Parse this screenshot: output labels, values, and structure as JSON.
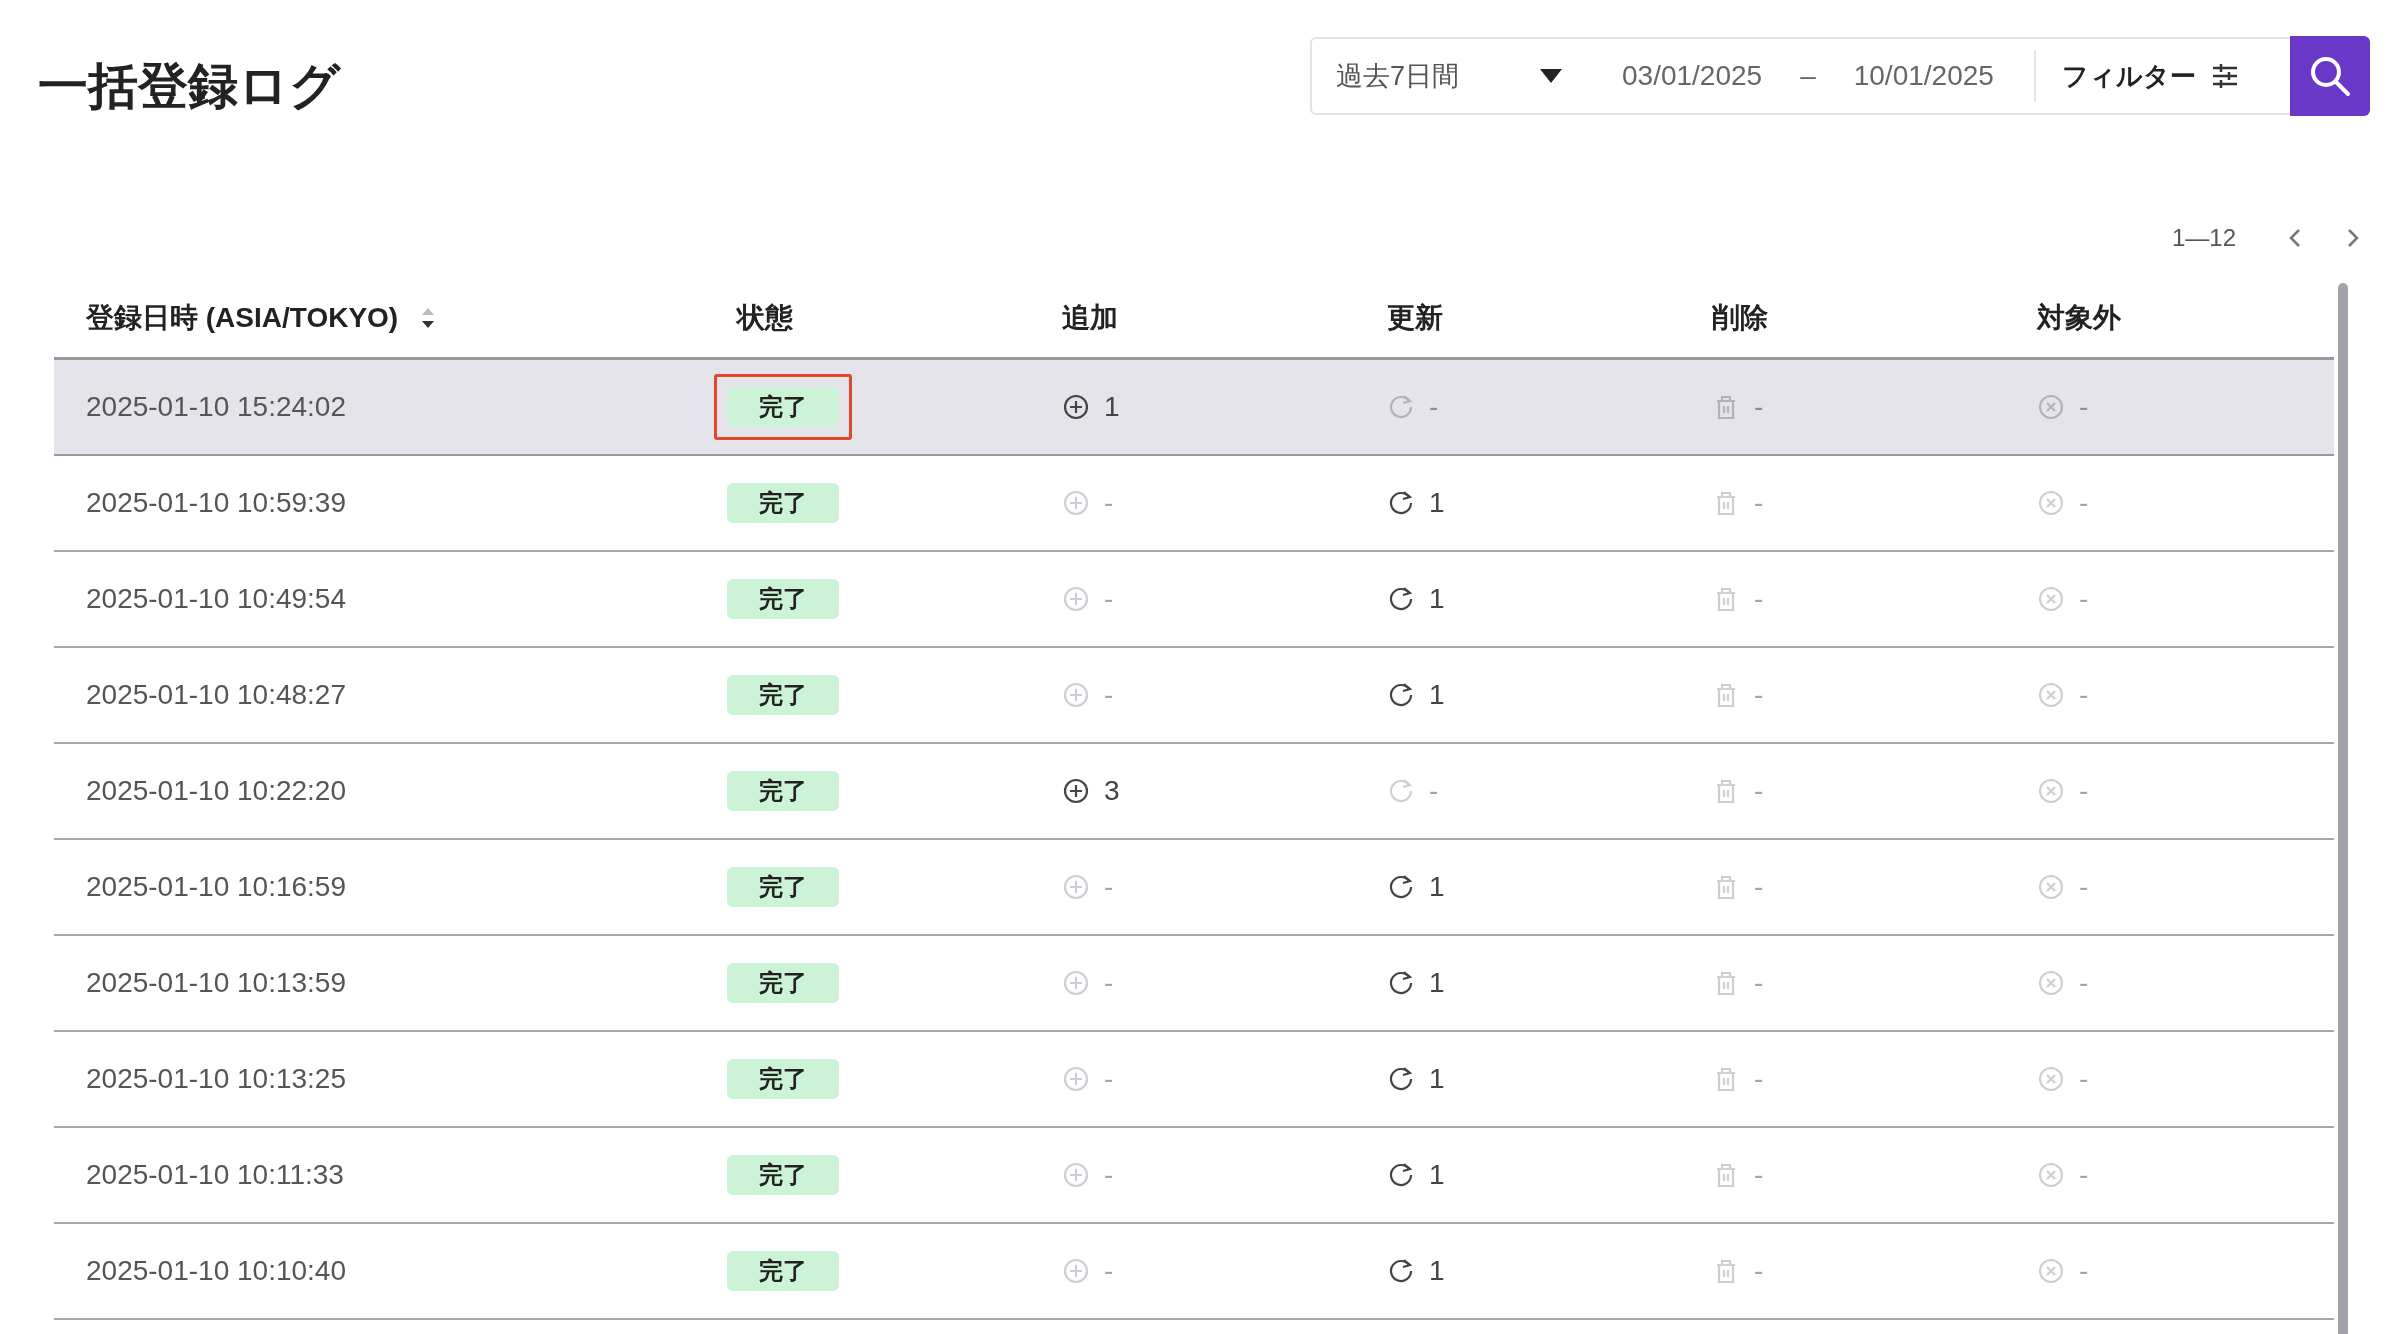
{
  "title": "一括登録ログ",
  "toolbar": {
    "period": "過去7日間",
    "date_from": "03/01/2025",
    "date_separator": "–",
    "date_to": "10/01/2025",
    "filter_label": "フィルター"
  },
  "pagination": {
    "range": "1—12"
  },
  "table": {
    "columns": [
      {
        "label": "登録日時 (ASIA/TOKYO)",
        "sortable": true
      },
      {
        "label": "状態",
        "sortable": false
      },
      {
        "label": "追加",
        "sortable": false
      },
      {
        "label": "更新",
        "sortable": false
      },
      {
        "label": "削除",
        "sortable": false
      },
      {
        "label": "対象外",
        "sortable": false
      }
    ],
    "rows": [
      {
        "datetime": "2025-01-10 15:24:02",
        "status": "完了",
        "selected": true,
        "status_outlined": true,
        "added": {
          "value": "1",
          "active": true
        },
        "updated": {
          "value": "-",
          "active": false
        },
        "deleted": {
          "value": "-",
          "active": false
        },
        "excluded": {
          "value": "-",
          "active": false
        }
      },
      {
        "datetime": "2025-01-10 10:59:39",
        "status": "完了",
        "selected": false,
        "status_outlined": false,
        "added": {
          "value": "-",
          "active": false
        },
        "updated": {
          "value": "1",
          "active": true
        },
        "deleted": {
          "value": "-",
          "active": false
        },
        "excluded": {
          "value": "-",
          "active": false
        }
      },
      {
        "datetime": "2025-01-10 10:49:54",
        "status": "完了",
        "selected": false,
        "status_outlined": false,
        "added": {
          "value": "-",
          "active": false
        },
        "updated": {
          "value": "1",
          "active": true
        },
        "deleted": {
          "value": "-",
          "active": false
        },
        "excluded": {
          "value": "-",
          "active": false
        }
      },
      {
        "datetime": "2025-01-10 10:48:27",
        "status": "完了",
        "selected": false,
        "status_outlined": false,
        "added": {
          "value": "-",
          "active": false
        },
        "updated": {
          "value": "1",
          "active": true
        },
        "deleted": {
          "value": "-",
          "active": false
        },
        "excluded": {
          "value": "-",
          "active": false
        }
      },
      {
        "datetime": "2025-01-10 10:22:20",
        "status": "完了",
        "selected": false,
        "status_outlined": false,
        "added": {
          "value": "3",
          "active": true
        },
        "updated": {
          "value": "-",
          "active": false
        },
        "deleted": {
          "value": "-",
          "active": false
        },
        "excluded": {
          "value": "-",
          "active": false
        }
      },
      {
        "datetime": "2025-01-10 10:16:59",
        "status": "完了",
        "selected": false,
        "status_outlined": false,
        "added": {
          "value": "-",
          "active": false
        },
        "updated": {
          "value": "1",
          "active": true
        },
        "deleted": {
          "value": "-",
          "active": false
        },
        "excluded": {
          "value": "-",
          "active": false
        }
      },
      {
        "datetime": "2025-01-10 10:13:59",
        "status": "完了",
        "selected": false,
        "status_outlined": false,
        "added": {
          "value": "-",
          "active": false
        },
        "updated": {
          "value": "1",
          "active": true
        },
        "deleted": {
          "value": "-",
          "active": false
        },
        "excluded": {
          "value": "-",
          "active": false
        }
      },
      {
        "datetime": "2025-01-10 10:13:25",
        "status": "完了",
        "selected": false,
        "status_outlined": false,
        "added": {
          "value": "-",
          "active": false
        },
        "updated": {
          "value": "1",
          "active": true
        },
        "deleted": {
          "value": "-",
          "active": false
        },
        "excluded": {
          "value": "-",
          "active": false
        }
      },
      {
        "datetime": "2025-01-10 10:11:33",
        "status": "完了",
        "selected": false,
        "status_outlined": false,
        "added": {
          "value": "-",
          "active": false
        },
        "updated": {
          "value": "1",
          "active": true
        },
        "deleted": {
          "value": "-",
          "active": false
        },
        "excluded": {
          "value": "-",
          "active": false
        }
      },
      {
        "datetime": "2025-01-10 10:10:40",
        "status": "完了",
        "selected": false,
        "status_outlined": false,
        "added": {
          "value": "-",
          "active": false
        },
        "updated": {
          "value": "1",
          "active": true
        },
        "deleted": {
          "value": "-",
          "active": false
        },
        "excluded": {
          "value": "-",
          "active": false
        }
      }
    ]
  }
}
